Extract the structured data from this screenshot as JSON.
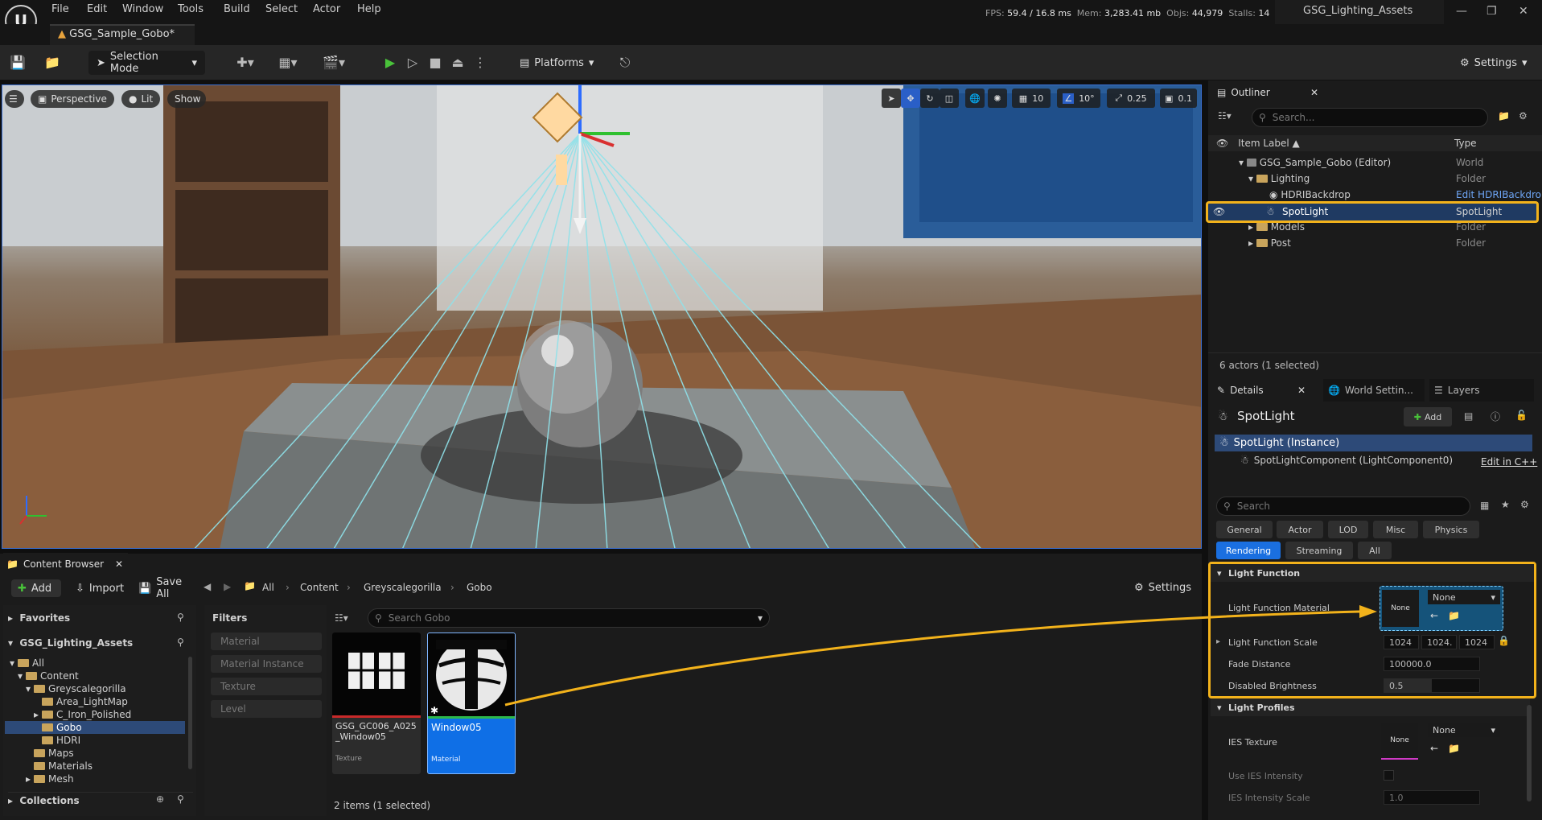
{
  "menu": [
    "File",
    "Edit",
    "Window",
    "Tools",
    "Build",
    "Select",
    "Actor",
    "Help"
  ],
  "stats": {
    "fps_label": "FPS:",
    "fps": "59.4",
    "ms": "/ 16.8 ms",
    "mem_label": "Mem:",
    "mem": "3,283.41 mb",
    "objs_label": "Objs:",
    "objs": "44,979",
    "stalls_label": "Stalls:",
    "stalls": "14"
  },
  "project_name": "GSG_Lighting_Assets",
  "level_tab": "GSG_Sample_Gobo*",
  "toolbar": {
    "selection_mode": "Selection Mode",
    "platforms": "Platforms",
    "settings": "Settings"
  },
  "viewport": {
    "perspective": "Perspective",
    "lit": "Lit",
    "show": "Show",
    "grid_snap": "10",
    "rot_snap": "10°",
    "scale_snap": "0.25",
    "cam_speed": "0.1"
  },
  "outliner": {
    "tab": "Outliner",
    "search_placeholder": "Search...",
    "col_label": "Item Label ▲",
    "col_type": "Type",
    "rows": [
      {
        "label": "GSG_Sample_Gobo (Editor)",
        "type": "World"
      },
      {
        "label": "Lighting",
        "type": "Folder"
      },
      {
        "label": "HDRIBackdrop",
        "type": "Edit HDRIBackdro"
      },
      {
        "label": "SpotLight",
        "type": "SpotLight"
      },
      {
        "label": "Models",
        "type": "Folder"
      },
      {
        "label": "Post",
        "type": "Folder"
      }
    ],
    "footer": "6 actors (1 selected)"
  },
  "details": {
    "tabs": [
      "Details",
      "World Settin...",
      "Layers"
    ],
    "actor_name": "SpotLight",
    "add_label": "Add",
    "instance": "SpotLight (Instance)",
    "component": "SpotLightComponent (LightComponent0)",
    "edit_cpp": "Edit in C++",
    "search_placeholder": "Search",
    "categories_row1": [
      "General",
      "Actor",
      "LOD",
      "Misc",
      "Physics"
    ],
    "categories_row2": [
      "Rendering",
      "Streaming",
      "All"
    ],
    "light_function": {
      "header": "Light Function",
      "material_label": "Light Function Material",
      "material_thumb": "None",
      "material_value": "None",
      "scale_label": "Light Function Scale",
      "scale": [
        "1024",
        "1024.",
        "1024"
      ],
      "fade_label": "Fade Distance",
      "fade_value": "100000.0",
      "disabled_label": "Disabled Brightness",
      "disabled_value": "0.5"
    },
    "light_profiles": {
      "header": "Light Profiles",
      "ies_label": "IES Texture",
      "ies_thumb": "None",
      "ies_value": "None",
      "use_ies_label": "Use IES Intensity",
      "ies_scale_label": "IES Intensity Scale",
      "ies_scale_value": "1.0"
    }
  },
  "content_browser": {
    "tab": "Content Browser",
    "add": "Add",
    "import": "Import",
    "save_all": "Save All",
    "breadcrumb": [
      "All",
      "Content",
      "Greyscalegorilla",
      "Gobo"
    ],
    "settings": "Settings",
    "favorites": "Favorites",
    "project": "GSG_Lighting_Assets",
    "tree": [
      "All",
      "Content",
      "Greyscalegorilla",
      "Area_LightMap",
      "C_Iron_Polished",
      "Gobo",
      "HDRI",
      "Maps",
      "Materials",
      "Mesh"
    ],
    "collections": "Collections",
    "filters_header": "Filters",
    "filters": [
      "Material",
      "Material Instance",
      "Texture",
      "Level"
    ],
    "search_placeholder": "Search Gobo",
    "assets": [
      {
        "name": "GSG_GC006_A025_Window05",
        "type": "Texture"
      },
      {
        "name": "Window05",
        "type": "Material"
      }
    ],
    "status": "2 items (1 selected)"
  }
}
